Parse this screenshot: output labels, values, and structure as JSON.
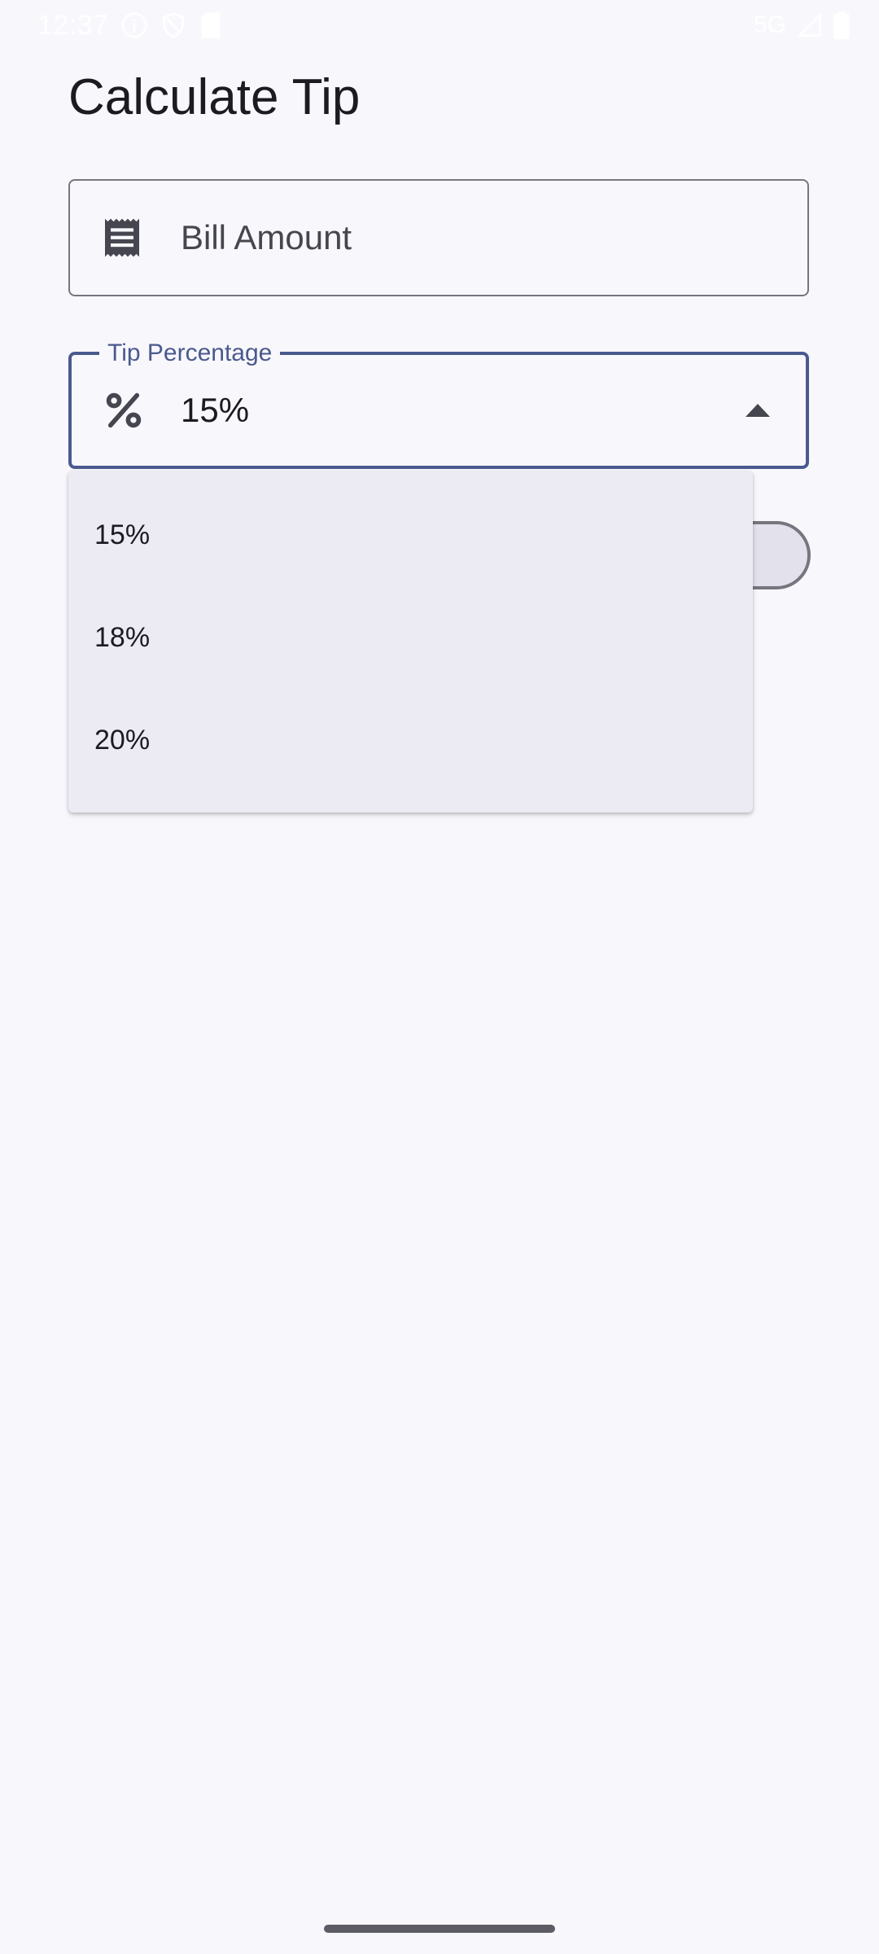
{
  "status_bar": {
    "time": "12:37",
    "network": "5G",
    "icons": [
      "info-icon",
      "shield-icon",
      "sim-card-icon",
      "signal-icon",
      "battery-icon"
    ]
  },
  "page": {
    "title": "Calculate Tip"
  },
  "bill_field": {
    "placeholder": "Bill Amount",
    "icon": "receipt-icon"
  },
  "tip_field": {
    "label": "Tip Percentage",
    "value": "15%",
    "icon": "percent-icon",
    "expanded": true
  },
  "tip_menu": {
    "options": [
      "15%",
      "18%",
      "20%"
    ]
  },
  "colors": {
    "background": "#f8f7fc",
    "primary": "#4a5a8e",
    "outline": "#76767f",
    "menu_surface": "#eceaf3"
  }
}
